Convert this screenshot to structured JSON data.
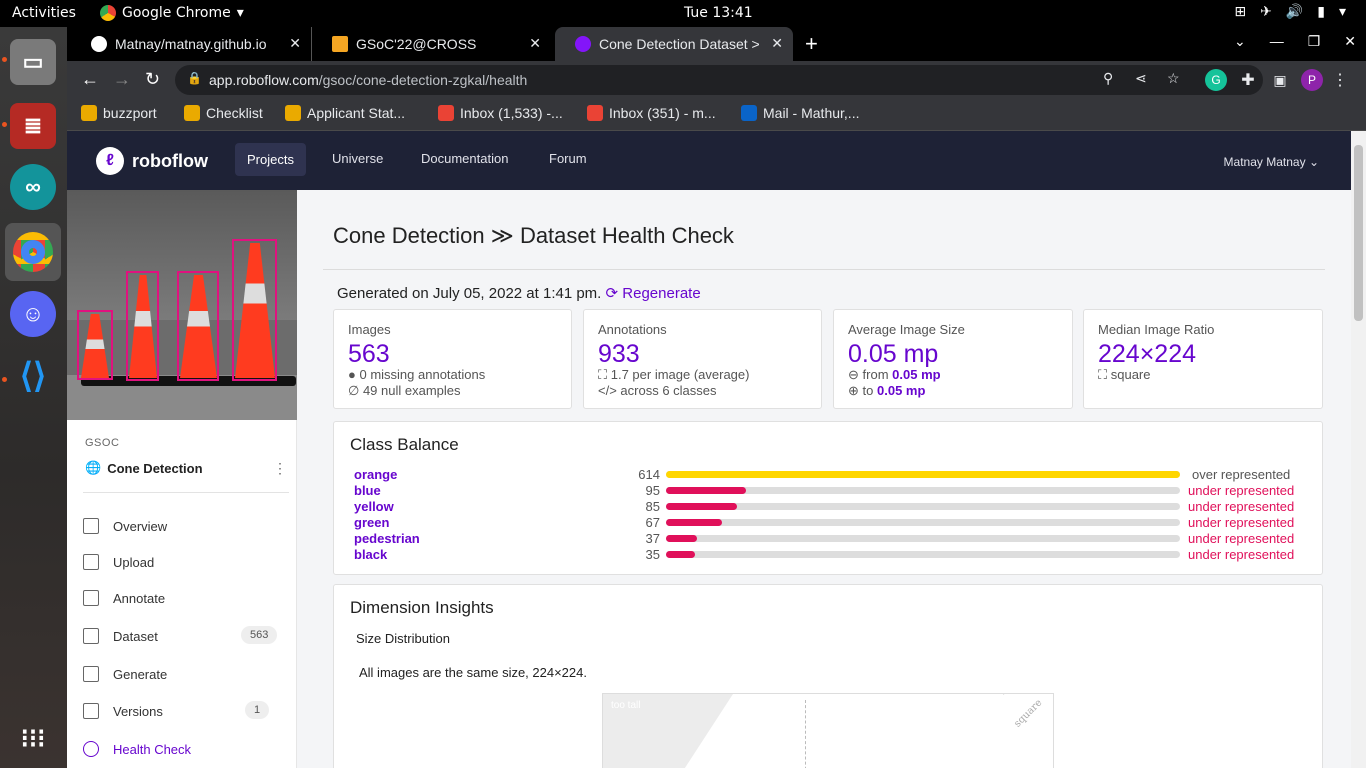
{
  "os": {
    "activities": "Activities",
    "app_name": "Google Chrome",
    "clock": "Tue 13:41"
  },
  "tabs": [
    {
      "title": "Matnay/matnay.github.io"
    },
    {
      "title": "GSoC'22@CROSS"
    },
    {
      "title": "Cone Detection Dataset >"
    }
  ],
  "url": {
    "host": "app.roboflow.com",
    "path": "/gsoc/cone-detection-zgkal/health"
  },
  "profile_initial": "P",
  "bookmarks": [
    {
      "label": "buzzport"
    },
    {
      "label": "Checklist"
    },
    {
      "label": "Applicant Stat..."
    },
    {
      "label": "Inbox (1,533) -..."
    },
    {
      "label": "Inbox (351) - m..."
    },
    {
      "label": "Mail - Mathur,..."
    }
  ],
  "rf_nav": {
    "brand": "roboflow",
    "links": [
      "Projects",
      "Universe",
      "Documentation",
      "Forum"
    ],
    "user": "Matnay Matnay"
  },
  "sidebar": {
    "workspace": "GSOC",
    "project": "Cone Detection",
    "items": [
      {
        "label": "Overview"
      },
      {
        "label": "Upload"
      },
      {
        "label": "Annotate"
      },
      {
        "label": "Dataset",
        "badge": "563"
      },
      {
        "label": "Generate"
      },
      {
        "label": "Versions",
        "badge": "1"
      },
      {
        "label": "Health Check"
      }
    ]
  },
  "page": {
    "project": "Cone Detection",
    "heading": "Dataset Health Check",
    "generated": "Generated on July 05, 2022 at 1:41 pm.",
    "regenerate": "Regenerate"
  },
  "stats": {
    "images": {
      "label": "Images",
      "value": "563",
      "line1": "0 missing annotations",
      "line2": "49 null examples"
    },
    "annotations": {
      "label": "Annotations",
      "value": "933",
      "line1": "1.7 per image (average)",
      "line2": "across 6 classes"
    },
    "avg_size": {
      "label": "Average Image Size",
      "value": "0.05 mp",
      "from_label": "from",
      "from_value": "0.05 mp",
      "to_label": "to",
      "to_value": "0.05 mp"
    },
    "ratio": {
      "label": "Median Image Ratio",
      "value": "224×224",
      "line1": "square"
    }
  },
  "class_balance": {
    "title": "Class Balance",
    "max": 614,
    "rows": [
      {
        "name": "orange",
        "count": 614,
        "status": "over represented",
        "color": "#ffd600"
      },
      {
        "name": "blue",
        "count": 95,
        "status": "under represented",
        "color": "#e0105a"
      },
      {
        "name": "yellow",
        "count": 85,
        "status": "under represented",
        "color": "#e0105a"
      },
      {
        "name": "green",
        "count": 67,
        "status": "under represented",
        "color": "#e0105a"
      },
      {
        "name": "pedestrian",
        "count": 37,
        "status": "under represented",
        "color": "#e0105a"
      },
      {
        "name": "black",
        "count": 35,
        "status": "under represented",
        "color": "#e0105a"
      }
    ]
  },
  "dimension": {
    "title": "Dimension Insights",
    "subtitle": "Size Distribution",
    "text": "All images are the same size, 224×224.",
    "plot_label_tall": "too tall",
    "plot_label_square": "square"
  }
}
